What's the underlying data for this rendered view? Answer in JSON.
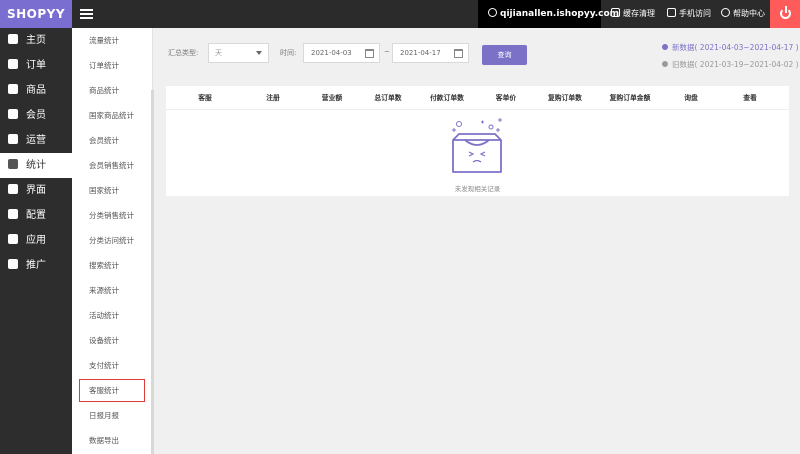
{
  "brand": {
    "logo": "SHOPYY"
  },
  "topbar": {
    "domain": "qijianallen.ishopyy.com",
    "links": [
      {
        "label": "缓存清理",
        "icon": "trash-icon"
      },
      {
        "label": "手机访问",
        "icon": "mobile-icon"
      },
      {
        "label": "帮助中心",
        "icon": "help-icon"
      }
    ],
    "power_icon": "power-icon"
  },
  "mainnav": [
    {
      "label": "主页",
      "icon": "home-icon"
    },
    {
      "label": "订单",
      "icon": "order-icon"
    },
    {
      "label": "商品",
      "icon": "box-icon"
    },
    {
      "label": "会员",
      "icon": "user-icon"
    },
    {
      "label": "运营",
      "icon": "megaphone-icon"
    },
    {
      "label": "统计",
      "icon": "chart-icon",
      "active": true
    },
    {
      "label": "界面",
      "icon": "layout-icon"
    },
    {
      "label": "配置",
      "icon": "gear-icon"
    },
    {
      "label": "应用",
      "icon": "puzzle-icon"
    },
    {
      "label": "推广",
      "icon": "send-icon"
    }
  ],
  "subnav": [
    "流量统计",
    "订单统计",
    "商品统计",
    "国家商品统计",
    "会员统计",
    "会员销售统计",
    "国家统计",
    "分类销售统计",
    "分类访问统计",
    "搜索统计",
    "来源统计",
    "活动统计",
    "设备统计",
    "支付统计",
    "客服统计",
    "日报月报",
    "数据导出"
  ],
  "filter": {
    "type_label": "汇总类型:",
    "type_value": "天",
    "time_label": "时间:",
    "start_date": "2021-04-03",
    "separator": "~",
    "end_date": "2021-04-17",
    "query_label": "查询"
  },
  "legend": {
    "new_label": "新数据",
    "new_range": "( 2021-04-03~2021-04-17 )",
    "old_label": "旧数据",
    "old_range": "( 2021-03-19~2021-04-02 )"
  },
  "table": {
    "columns": [
      "客服",
      "注册",
      "营业额",
      "总订单数",
      "付款订单数",
      "客单价",
      "复购订单数",
      "复购订单金额",
      "询盘",
      "查看"
    ],
    "empty_text": "未发现相关记录"
  },
  "colors": {
    "accent": "#7b72c8",
    "topbar": "#2b2b2b",
    "danger": "#ff5b5b"
  }
}
